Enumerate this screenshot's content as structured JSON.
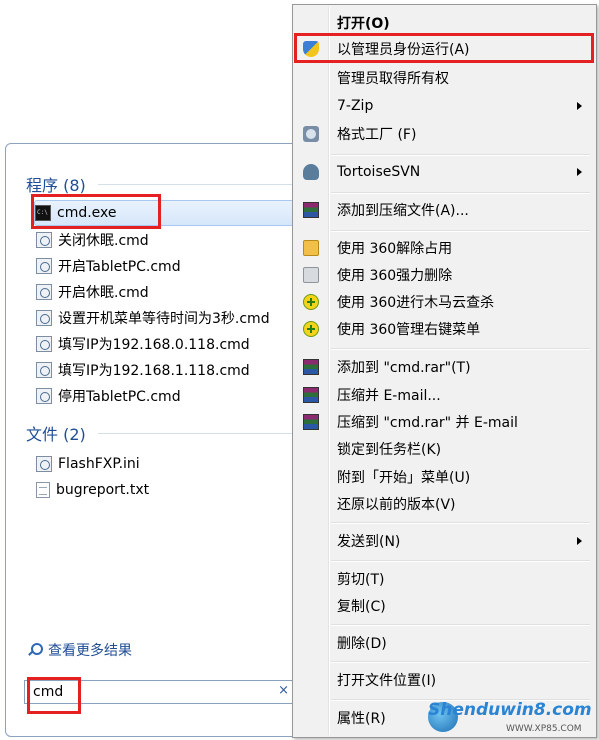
{
  "start_menu": {
    "programs_header": "程序 (8)",
    "programs": [
      {
        "label": "cmd.exe",
        "icon": "cmd-console-icon"
      },
      {
        "label": "关闭休眠.cmd",
        "icon": "batch-file-icon"
      },
      {
        "label": "开启TabletPC.cmd",
        "icon": "batch-file-icon"
      },
      {
        "label": "开启休眠.cmd",
        "icon": "batch-file-icon"
      },
      {
        "label": "设置开机菜单等待时间为3秒.cmd",
        "icon": "batch-file-icon"
      },
      {
        "label": "填写IP为192.168.0.118.cmd",
        "icon": "batch-file-icon"
      },
      {
        "label": "填写IP为192.168.1.118.cmd",
        "icon": "batch-file-icon"
      },
      {
        "label": "停用TabletPC.cmd",
        "icon": "batch-file-icon"
      }
    ],
    "files_header": "文件 (2)",
    "files": [
      {
        "label": "FlashFXP.ini",
        "icon": "ini-file-icon"
      },
      {
        "label": "bugreport.txt",
        "icon": "text-file-icon"
      }
    ],
    "more_results": "查看更多结果",
    "search_value": "cmd",
    "clear_glyph": "×"
  },
  "context_menu": {
    "items": [
      {
        "label": "打开(O)",
        "icon": "",
        "bold": true
      },
      {
        "label": "以管理员身份运行(A)",
        "icon": "uac-shield-icon"
      },
      {
        "label": "管理员取得所有权",
        "icon": ""
      },
      {
        "label": "7-Zip",
        "icon": "",
        "submenu": true
      },
      {
        "label": "格式工厂 (F)",
        "icon": "format-factory-icon"
      },
      {
        "label": "TortoiseSVN",
        "icon": "tortoise-svn-icon",
        "submenu": true
      },
      {
        "label": "添加到压缩文件(A)...",
        "icon": "winrar-icon"
      },
      {
        "label": "使用 360解除占用",
        "icon": "360-unlock-icon"
      },
      {
        "label": "使用 360强力删除",
        "icon": "360-shred-icon"
      },
      {
        "label": "使用 360进行木马云查杀",
        "icon": "360-scan-icon"
      },
      {
        "label": "使用 360管理右键菜单",
        "icon": "360-menu-icon"
      },
      {
        "label": "添加到 \"cmd.rar\"(T)",
        "icon": "winrar-icon"
      },
      {
        "label": "压缩并 E-mail...",
        "icon": "winrar-icon"
      },
      {
        "label": "压缩到 \"cmd.rar\" 并 E-mail",
        "icon": "winrar-icon"
      },
      {
        "label": "锁定到任务栏(K)",
        "icon": ""
      },
      {
        "label": "附到「开始」菜单(U)",
        "icon": ""
      },
      {
        "label": "还原以前的版本(V)",
        "icon": ""
      },
      {
        "label": "发送到(N)",
        "icon": "",
        "submenu": true
      },
      {
        "label": "剪切(T)",
        "icon": ""
      },
      {
        "label": "复制(C)",
        "icon": ""
      },
      {
        "label": "删除(D)",
        "icon": ""
      },
      {
        "label": "打开文件位置(I)",
        "icon": ""
      },
      {
        "label": "属性(R)",
        "icon": ""
      }
    ]
  },
  "watermark": {
    "text": "Shenduwin8.com",
    "sub": "WWW.XP85.COM"
  },
  "colors": {
    "annotation_red": "#e52020",
    "section_header_blue": "#1f4e96",
    "menu_background": "#f1f1f1"
  }
}
